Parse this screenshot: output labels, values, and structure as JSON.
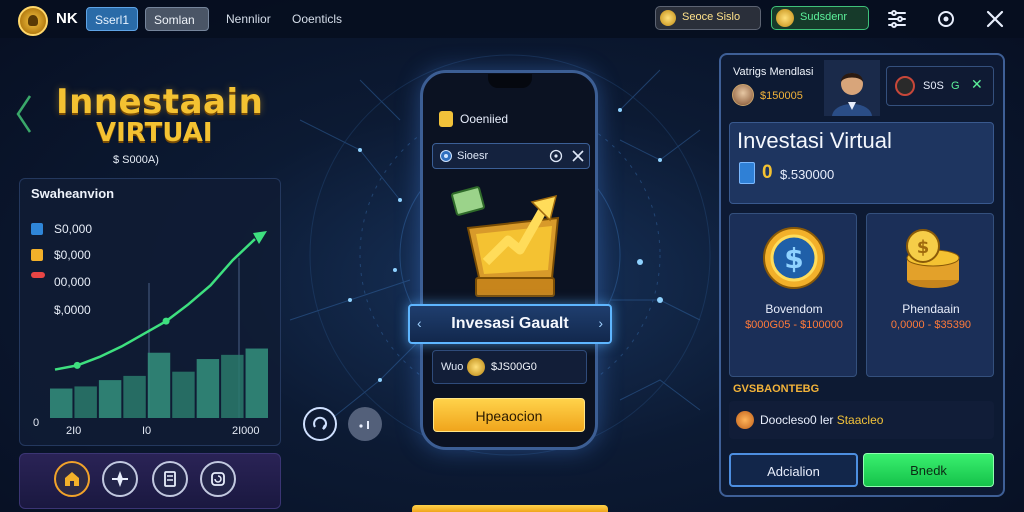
{
  "topbar": {
    "brand": "NK",
    "nav": [
      "Sserl1",
      "Somlan",
      "Nennlior",
      "Ooenticls"
    ],
    "coin_balance": "Seoce Sislo",
    "gem_balance": "Sudsdenr"
  },
  "left": {
    "title_line1": "Innestaain",
    "title_line2": "VIRTUAI",
    "amount": "$ S000A)",
    "chart_title": "Swaheanvion"
  },
  "chart_data": {
    "type": "bar",
    "title": "Swaheanvion",
    "legend": [
      {
        "label": "S0,000",
        "color": "#2f86d8"
      },
      {
        "label": "$0,000",
        "color": "#f2b02a"
      },
      {
        "label": "00,000",
        "color": "#e84545"
      },
      {
        "label": "$,0000",
        "color": ""
      }
    ],
    "x_ticks": [
      "2I0",
      "I0",
      "2I000"
    ],
    "y_ticks": [
      "0"
    ],
    "values": [
      28,
      30,
      36,
      40,
      62,
      44,
      56,
      60,
      66
    ],
    "trend": [
      46,
      50,
      58,
      68,
      80,
      92,
      108,
      126,
      150,
      170
    ],
    "trend_color": "#3ee07f",
    "ylim": [
      0,
      190
    ]
  },
  "toolbar": {
    "items": [
      "home-icon",
      "compass-icon",
      "book-icon",
      "refresh-icon"
    ]
  },
  "phone": {
    "header": "Ooeniied",
    "search_value": "Sioesr",
    "banner": "Invesasi Gaualt",
    "amount_label": "Wuo",
    "amount_value": "$JS00G0",
    "cta": "Hpeaocion"
  },
  "side_buttons": [
    "refresh-icon",
    "ellipsis-icon"
  ],
  "right": {
    "header": "Vatrigs Mendlasi",
    "user_amount": "$150005",
    "mini_value": "S0S",
    "mini_green": "G",
    "card_title": "Investasi Virtual",
    "card_zero": "0",
    "card_value": "$.530000",
    "options": [
      {
        "name": "Bovendom",
        "value": "$000G05 - $100000"
      },
      {
        "name": "Phendaain",
        "value": "0,0000 - $35390"
      }
    ],
    "section": "GVSBAONTEBG",
    "info_text": "Doocleso0 ler",
    "info_highlight": "Staacleo",
    "button_left": "Adcialion",
    "button_right": "Bnedk"
  },
  "colors": {
    "accent_gold": "#f4c232",
    "accent_green": "#3ee07f",
    "panel_border": "#3e5f96"
  }
}
